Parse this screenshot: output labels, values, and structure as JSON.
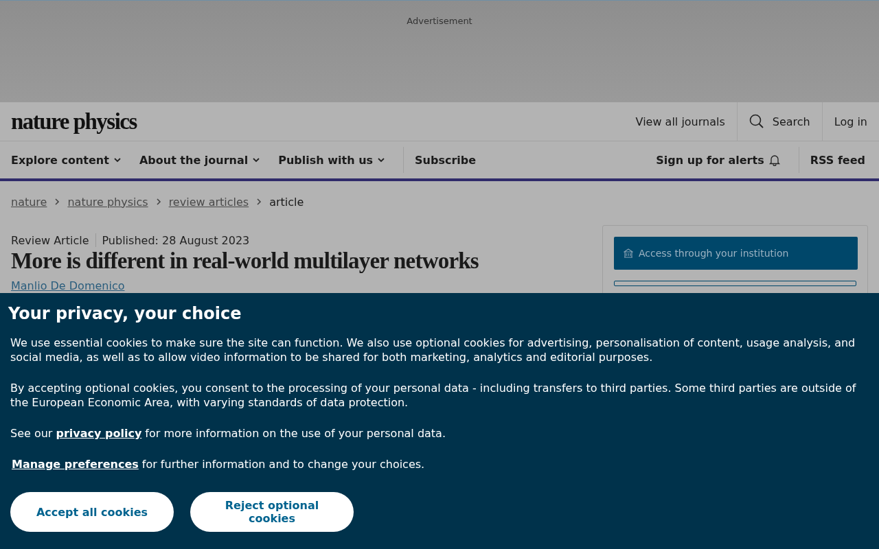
{
  "advert": {
    "label": "Advertisement"
  },
  "header": {
    "logo": "nature physics",
    "links": [
      {
        "label": "View all journals",
        "kind": "link"
      },
      {
        "label": "Search",
        "kind": "search"
      },
      {
        "label": "Log in",
        "kind": "link"
      }
    ]
  },
  "nav": {
    "items": [
      {
        "label": "Explore content",
        "kind": "menu"
      },
      {
        "label": "About the journal",
        "kind": "menu"
      },
      {
        "label": "Publish with us",
        "kind": "menu"
      },
      {
        "label": "Subscribe",
        "kind": "link"
      }
    ],
    "right": [
      {
        "label": "Sign up for alerts",
        "kind": "alerts"
      },
      {
        "label": "RSS feed",
        "kind": "link"
      }
    ]
  },
  "breadcrumbs": [
    {
      "label": "nature",
      "kind": "link"
    },
    {
      "label": "nature physics",
      "kind": "link"
    },
    {
      "label": "review articles",
      "kind": "link"
    },
    {
      "label": "article",
      "kind": "current"
    }
  ],
  "article": {
    "type": "Review Article",
    "published": "Published: 28 August 2023",
    "title": "More is different in real-world multilayer networks",
    "author": "Manlio De Domenico"
  },
  "sidebar": {
    "access_button": "Access through your institution"
  },
  "cookie_banner": {
    "title": "Your privacy, your choice",
    "paragraphs": [
      "We use essential cookies to make sure the site can function. We also use optional cookies for advertising, personalisation of content, usage analysis, and social media, as well as to allow video information to be shared for both marketing, analytics and editorial purposes.",
      "By accepting optional cookies, you consent to the processing of your personal data - including transfers to third parties. Some third parties are outside of the European Economic Area, with varying standards of data protection."
    ],
    "policy_line": {
      "before": "See our",
      "link": "privacy policy",
      "after": "for more information on the use of your personal data."
    },
    "manage_line": {
      "link": "Manage preferences",
      "after": "for further information and to change your choices."
    },
    "buttons": [
      "Accept all cookies",
      "Reject optional cookies"
    ]
  }
}
